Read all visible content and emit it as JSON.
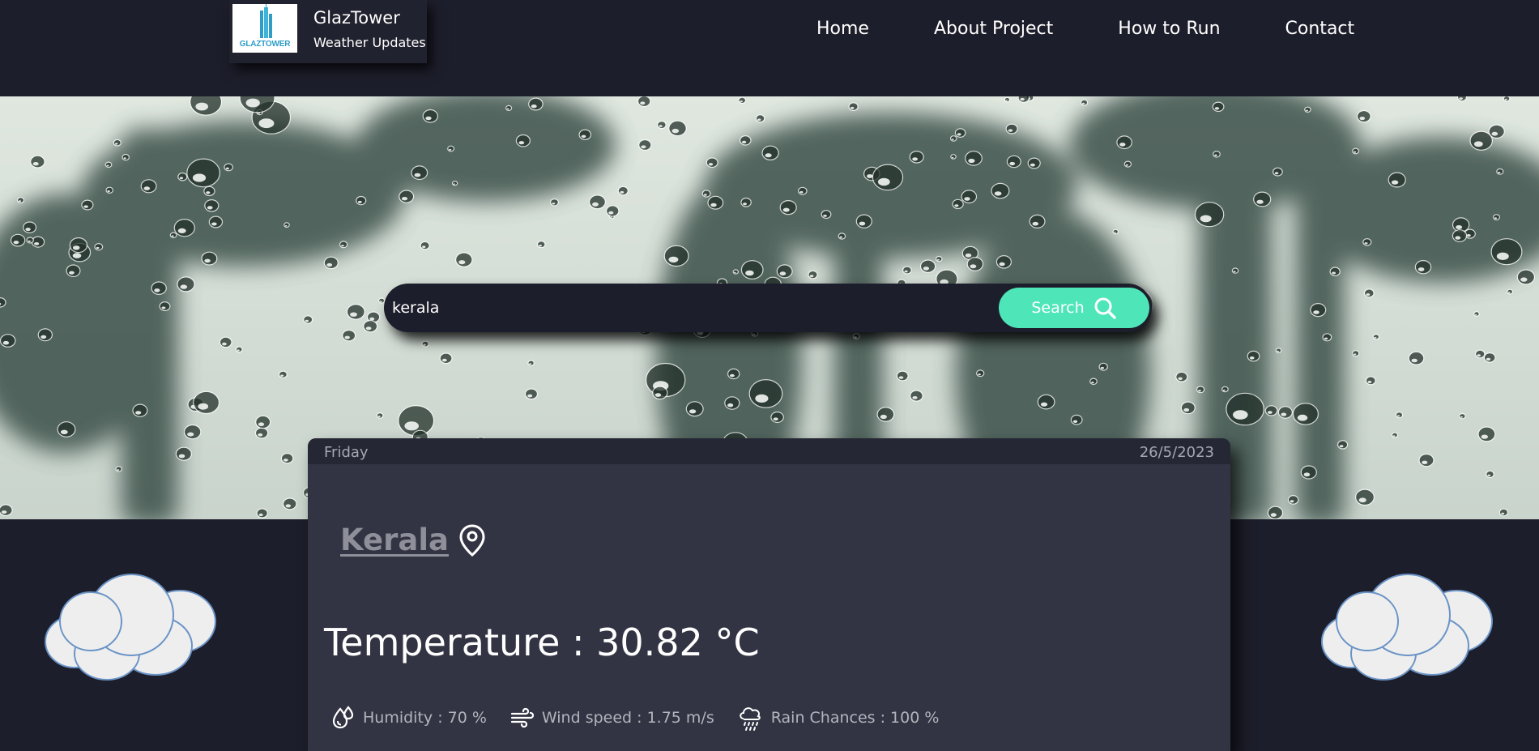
{
  "brand": {
    "title": "GlazTower",
    "subtitle": "Weather Updates",
    "logo_text": "GLAZTOWER"
  },
  "nav": {
    "items": [
      "Home",
      "About Project",
      "How to Run",
      "Contact"
    ]
  },
  "search": {
    "value": "kerala",
    "button_label": "Search"
  },
  "weather": {
    "day": "Friday",
    "date": "26/5/2023",
    "city": "Kerala",
    "temperature": "Temperature : 30.82 °C",
    "humidity": "Humidity : 70 %",
    "wind": "Wind speed : 1.75 m/s",
    "rain": "Rain Chances : 100 %"
  },
  "colors": {
    "background": "#1d1e2b",
    "card": "#323443",
    "accent": "#4ee6b9"
  }
}
